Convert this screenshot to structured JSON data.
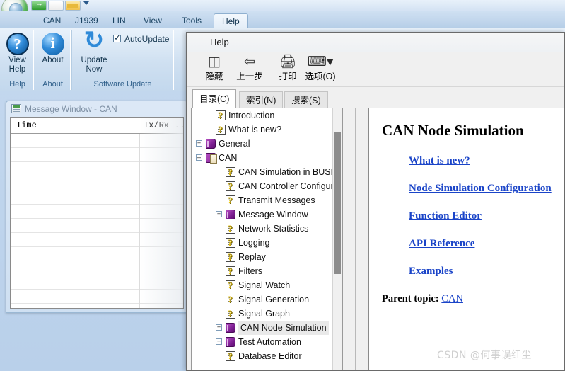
{
  "app": {
    "quick_access": [
      {
        "name": "send-icon",
        "glyph": "→"
      },
      {
        "name": "new-document-icon",
        "glyph": ""
      },
      {
        "name": "open-folder-icon",
        "glyph": ""
      }
    ],
    "ribbon_tabs": [
      {
        "label": "CAN",
        "active": false
      },
      {
        "label": "J1939",
        "active": false
      },
      {
        "label": "LIN",
        "active": false
      },
      {
        "label": "View",
        "active": false
      },
      {
        "label": "Tools",
        "active": false
      },
      {
        "label": "Help",
        "active": true
      }
    ],
    "ribbon_groups": [
      {
        "group_label": "Help",
        "button_label": "View\nHelp",
        "button_line1": "View",
        "button_line2": "Help"
      },
      {
        "group_label": "About",
        "button_label": "About",
        "button_line1": "About",
        "button_line2": ""
      },
      {
        "group_label": "Software Update",
        "button_line1": "Update",
        "button_line2": "Now",
        "checkbox_label": "AutoUpdate",
        "checkbox_checked": true
      }
    ]
  },
  "message_window": {
    "title": "Message Window - CAN",
    "columns": [
      "Time",
      "Tx/Rx",
      "..."
    ],
    "rows": []
  },
  "help_window": {
    "title": "Help",
    "toolbar": [
      {
        "label": "隐藏",
        "icon": "hide-pane-icon",
        "glyph": "❐"
      },
      {
        "label": "上一步",
        "icon": "back-arrow-icon",
        "glyph": "⇦"
      },
      {
        "label": "打印",
        "icon": "printer-icon",
        "glyph": "⎙"
      },
      {
        "label": "选项(O)",
        "icon": "options-icon",
        "glyph": "⎘"
      }
    ],
    "tabs": [
      {
        "label": "目录(C)",
        "active": true
      },
      {
        "label": "索引(N)",
        "active": false
      },
      {
        "label": "搜索(S)",
        "active": false
      }
    ],
    "tree": [
      {
        "label": "Introduction",
        "icon": "topic-icon",
        "indent": 1,
        "expander": "",
        "selected": false
      },
      {
        "label": "What is new?",
        "icon": "topic-icon",
        "indent": 1,
        "expander": "",
        "selected": false
      },
      {
        "label": "General",
        "icon": "book-icon",
        "indent": 0,
        "expander": "+",
        "selected": false
      },
      {
        "label": "CAN",
        "icon": "book-open-icon",
        "indent": 0,
        "expander": "-",
        "selected": false
      },
      {
        "label": "CAN Simulation in BUSM",
        "icon": "topic-icon",
        "indent": 2,
        "expander": "",
        "selected": false
      },
      {
        "label": "CAN Controller Configur",
        "icon": "topic-icon",
        "indent": 2,
        "expander": "",
        "selected": false
      },
      {
        "label": "Transmit Messages",
        "icon": "topic-icon",
        "indent": 2,
        "expander": "",
        "selected": false
      },
      {
        "label": "Message Window",
        "icon": "book-icon",
        "indent": 1,
        "expander": "+",
        "selected": false
      },
      {
        "label": "Network Statistics",
        "icon": "topic-icon",
        "indent": 2,
        "expander": "",
        "selected": false
      },
      {
        "label": "Logging",
        "icon": "topic-icon",
        "indent": 2,
        "expander": "",
        "selected": false
      },
      {
        "label": "Replay",
        "icon": "topic-icon",
        "indent": 2,
        "expander": "",
        "selected": false
      },
      {
        "label": "Filters",
        "icon": "topic-icon",
        "indent": 2,
        "expander": "",
        "selected": false
      },
      {
        "label": "Signal Watch",
        "icon": "topic-icon",
        "indent": 2,
        "expander": "",
        "selected": false
      },
      {
        "label": "Signal Generation",
        "icon": "topic-icon",
        "indent": 2,
        "expander": "",
        "selected": false
      },
      {
        "label": "Signal Graph",
        "icon": "topic-icon",
        "indent": 2,
        "expander": "",
        "selected": false
      },
      {
        "label": "CAN Node Simulation",
        "icon": "book-icon",
        "indent": 1,
        "expander": "+",
        "selected": true
      },
      {
        "label": "Test Automation",
        "icon": "book-icon",
        "indent": 1,
        "expander": "+",
        "selected": false
      },
      {
        "label": "Database Editor",
        "icon": "topic-icon",
        "indent": 2,
        "expander": "",
        "selected": false
      }
    ],
    "content": {
      "heading": "CAN Node Simulation",
      "links": [
        "What is new?",
        "Node Simulation Configuration",
        "Function Editor",
        "API Reference",
        "Examples"
      ],
      "parent_label": "Parent topic: ",
      "parent_link": "CAN"
    }
  },
  "watermark": "CSDN @何事误红尘",
  "colors": {
    "ribbon_accent": "#17405f",
    "link": "#1a44c8",
    "selection": "#e9e9e9"
  }
}
